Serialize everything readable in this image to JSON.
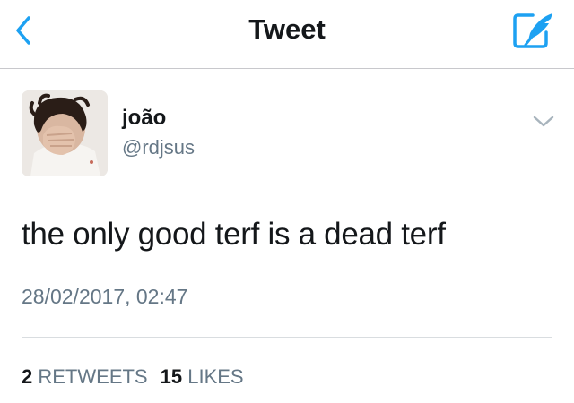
{
  "header": {
    "title": "Tweet",
    "back_icon": "chevron-left-icon",
    "compose_icon": "compose-quill-icon",
    "accent_color": "#1da1f2"
  },
  "tweet": {
    "author": {
      "display_name": "joão",
      "handle": "@rdjsus"
    },
    "text": "the only good terf is a dead terf",
    "timestamp": "28/02/2017, 02:47",
    "menu_icon": "chevron-down-icon",
    "stats": {
      "retweets_count": "2",
      "retweets_label": "RETWEETS",
      "likes_count": "15",
      "likes_label": "LIKES"
    }
  },
  "colors": {
    "primary_text": "#14171a",
    "secondary_text": "#657786",
    "divider": "#d9dde0"
  }
}
